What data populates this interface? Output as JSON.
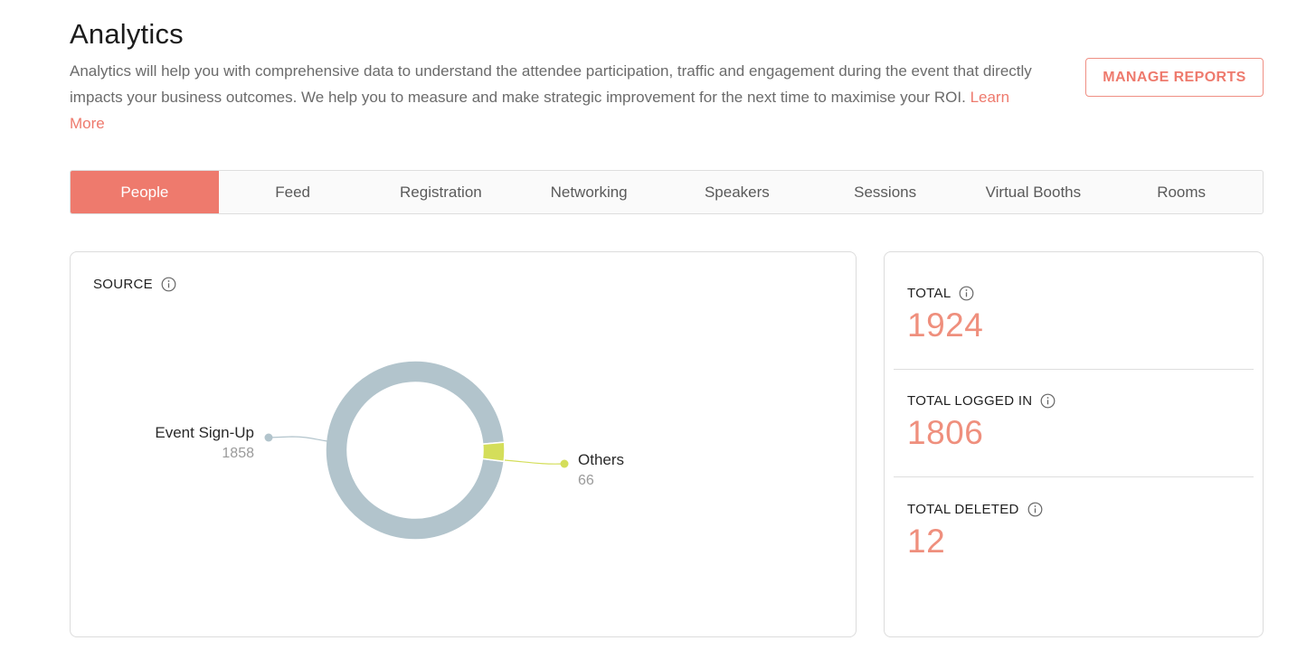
{
  "header": {
    "title": "Analytics",
    "description": "Analytics will help you with comprehensive data to understand the attendee participation, traffic and engagement during the event that directly impacts your business outcomes. We help you to measure and make strategic improvement for the next time to maximise your ROI.",
    "learn_more": "Learn More",
    "manage_reports": "MANAGE REPORTS"
  },
  "tabs": [
    {
      "label": "People",
      "active": true
    },
    {
      "label": "Feed"
    },
    {
      "label": "Registration"
    },
    {
      "label": "Networking"
    },
    {
      "label": "Speakers"
    },
    {
      "label": "Sessions"
    },
    {
      "label": "Virtual Booths"
    },
    {
      "label": "Rooms"
    }
  ],
  "source": {
    "label": "SOURCE",
    "info_icon": "info-circle-icon"
  },
  "chart_data": {
    "type": "pie",
    "donut": true,
    "slices": [
      {
        "name": "Event Sign-Up",
        "value": 1858,
        "color": "#b2c4cc"
      },
      {
        "name": "Others",
        "value": 66,
        "color": "#d4de5a"
      }
    ]
  },
  "stats": {
    "total": {
      "label": "TOTAL",
      "value": "1924"
    },
    "logged_in": {
      "label": "TOTAL LOGGED IN",
      "value": "1806"
    },
    "deleted": {
      "label": "TOTAL DELETED",
      "value": "12"
    }
  },
  "colors": {
    "accent": "#ee7a6d",
    "stat_value": "#ef8f7d"
  }
}
